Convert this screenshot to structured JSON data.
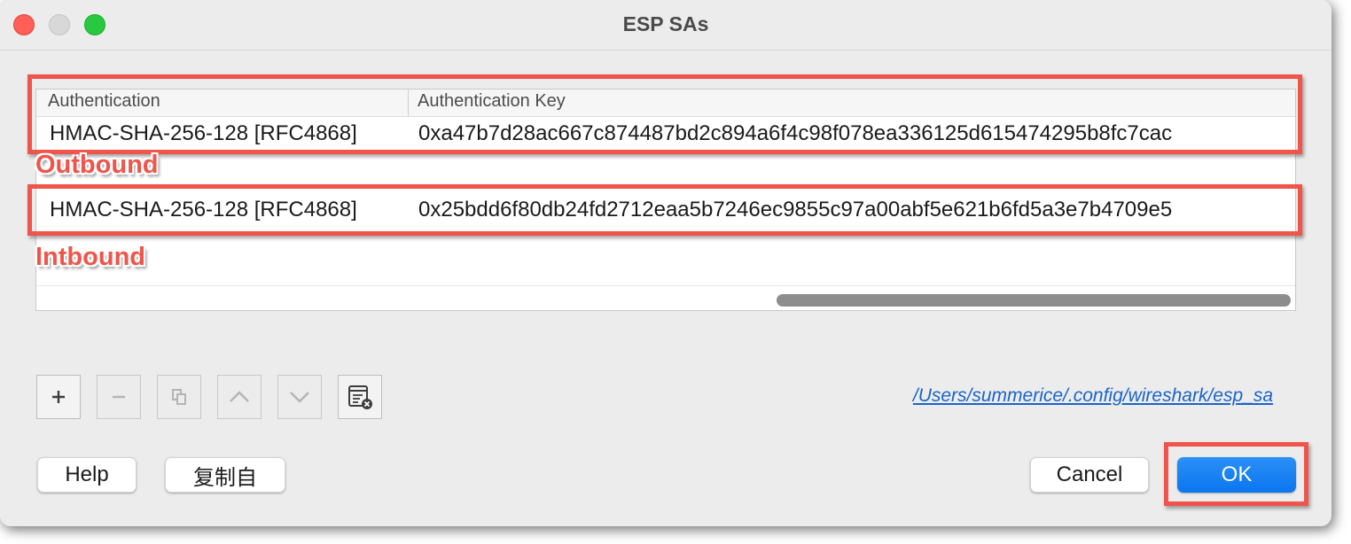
{
  "window": {
    "title": "ESP SAs"
  },
  "table": {
    "columns": [
      "Authentication",
      "Authentication Key"
    ],
    "rows": [
      {
        "authentication": "HMAC-SHA-256-128 [RFC4868]",
        "key": "0xa47b7d28ac667c874487bd2c894a6f4c98f078ea336125d615474295b8fc7cac"
      },
      {
        "authentication": "HMAC-SHA-256-128 [RFC4868]",
        "key": "0x25bdd6f80db24fd2712eaa5b7246ec9855c97a00abf5e621b6fd5a3e7b4709e5"
      }
    ]
  },
  "annotations": {
    "outbound": "Outbound",
    "inbound": "Intbound",
    "highlight_color": "#f0554b"
  },
  "toolbar": {
    "add_icon": "plus-icon",
    "remove_icon": "minus-icon",
    "copy_icon": "copy-icon",
    "up_icon": "chevron-up-icon",
    "down_icon": "chevron-down-icon",
    "clear_icon": "clear-list-icon"
  },
  "file_path": "/Users/summerice/.config/wireshark/esp_sa",
  "buttons": {
    "help": "Help",
    "copy_from": "复制自",
    "cancel": "Cancel",
    "ok": "OK"
  },
  "colors": {
    "accent": "#0a76f0",
    "link": "#1a64c8"
  }
}
